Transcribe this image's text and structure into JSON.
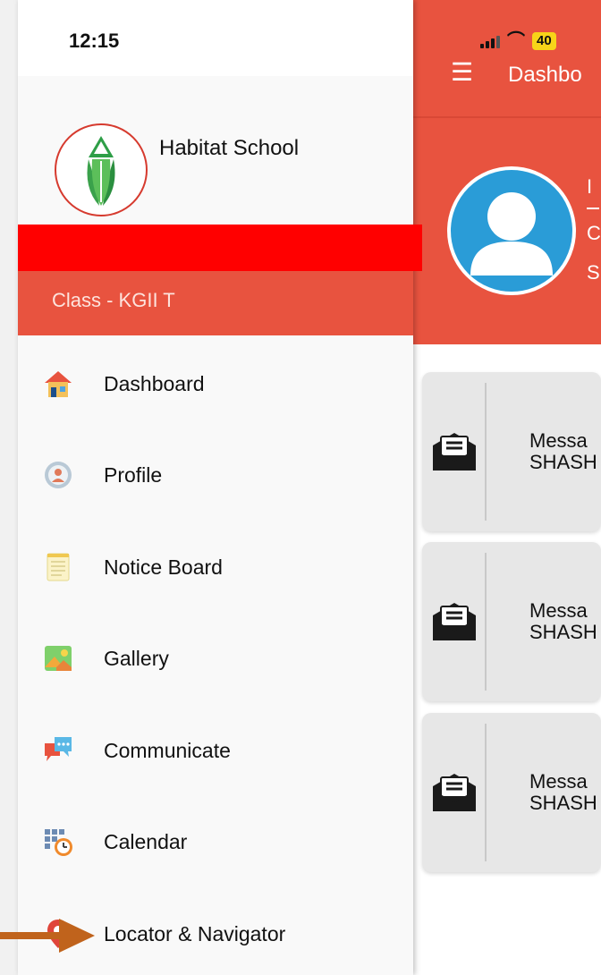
{
  "status_bar": {
    "time": "12:15",
    "battery": "40"
  },
  "dashboard": {
    "title": "Dashbo",
    "header_lines": [
      "I",
      "C",
      "S"
    ],
    "messages": [
      {
        "line1": "Messa",
        "line2": "SHASH"
      },
      {
        "line1": "Messa",
        "line2": "SHASH"
      },
      {
        "line1": "Messa",
        "line2": "SHASH"
      }
    ]
  },
  "drawer": {
    "school_name": "Habitat School",
    "class_label": "Class - KGII T",
    "menu": [
      {
        "label": "Dashboard",
        "icon": "house-icon"
      },
      {
        "label": "Profile",
        "icon": "profile-icon"
      },
      {
        "label": "Notice Board",
        "icon": "notepad-icon"
      },
      {
        "label": "Gallery",
        "icon": "picture-icon"
      },
      {
        "label": "Communicate",
        "icon": "chat-icon"
      },
      {
        "label": "Calendar",
        "icon": "calendar-clock-icon"
      },
      {
        "label": "Locator & Navigator",
        "icon": "map-pin-icon"
      }
    ]
  },
  "colors": {
    "accent": "#e8533f",
    "redaction": "#ff0000",
    "avatar_blue": "#2a9cd7",
    "annotation_arrow": "#c0631c"
  }
}
